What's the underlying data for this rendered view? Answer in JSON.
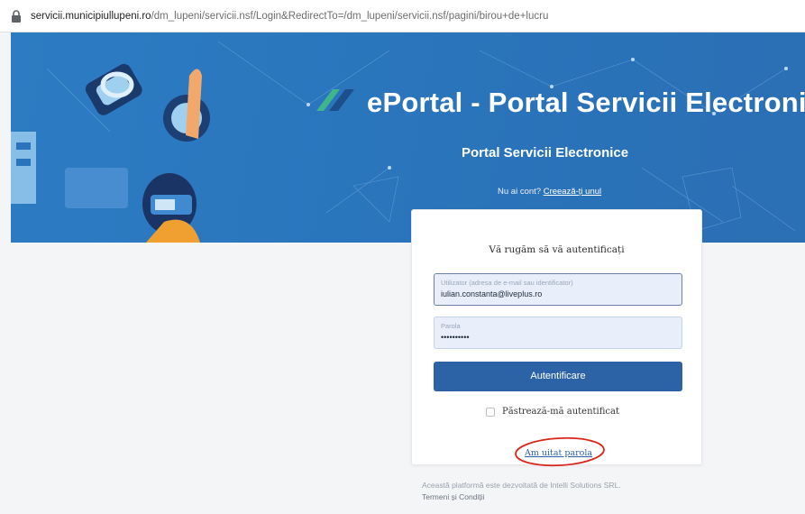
{
  "browser": {
    "url_host": "servicii.municipiullupeni.ro",
    "url_path": "/dm_lupeni/servicii.nsf/Login&RedirectTo=/dm_lupeni/servicii.nsf/pagini/birou+de+lucru"
  },
  "header": {
    "brand": "ePortal - Portal Servicii Electronice",
    "subtitle": "Portal Servicii Electronice",
    "no_account_text": "Nu ai cont?",
    "create_account_link": "Creează-ți unul"
  },
  "login": {
    "title": "Vă rugăm să vă autentificați",
    "username_label": "Utilizator (adresa de e-mail sau identificator)",
    "username_value": "iulian.constanta@liveplus.ro",
    "password_label": "Parola",
    "password_value": "••••••••••",
    "submit_label": "Autentificare",
    "remember_label": "Păstrează-mă autentificat",
    "forgot_label": "Am uitat parola"
  },
  "footer": {
    "line1": "Această platformă este dezvoltată de Intelli Solutions SRL.",
    "terms_link": "Termeni și Condiții"
  },
  "colors": {
    "banner": "#2a74bb",
    "primary_button": "#2c63a6",
    "annotation_circle": "#d9261c"
  }
}
